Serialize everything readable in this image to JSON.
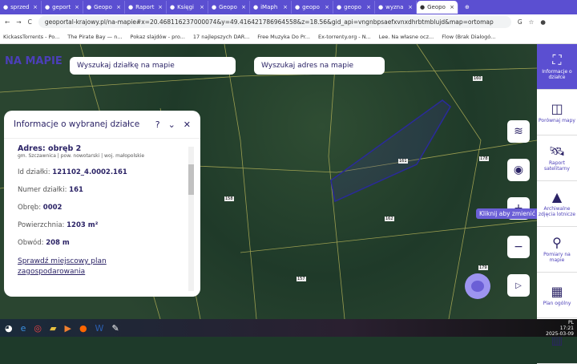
{
  "browser": {
    "tabs": [
      {
        "label": "sprzed"
      },
      {
        "label": "geport"
      },
      {
        "label": "Geopo"
      },
      {
        "label": "Raport"
      },
      {
        "label": "Księgi"
      },
      {
        "label": "Geopo"
      },
      {
        "label": "iMaph"
      },
      {
        "label": "geopo"
      },
      {
        "label": "geopo"
      },
      {
        "label": "wyzna"
      },
      {
        "label": "Geopo",
        "active": true
      }
    ],
    "url": "geoportal-krajowy.pl/na-mapie#x=20.468116237000074&y=49.416421786964558&z=18.56&gid_api=vngnbpsaefxvnxdhrbtmblujd&map=ortomap",
    "bookmarks": [
      "KickassTorrents - Po...",
      "The Pirate Bay — n...",
      "Pokaz slajdów - pro...",
      "17 najlepszych DAR...",
      "Free Muzyka Do Pr...",
      "Ex-torrenty.org - N...",
      "Lee. Na własne ocz...",
      "Flow (Brak Dialogó..."
    ]
  },
  "logo": "NA MAPIE",
  "search": {
    "parcel": "Wyszukaj działkę na mapie",
    "address": "Wyszukaj adres na mapie"
  },
  "panel": {
    "title": "Informacje o wybranej działce",
    "address": "Adres: obręb 2",
    "subaddress": "gm. Szczawnica | pow. nowotarski | woj. małopolskie",
    "fields": [
      {
        "label": "Id działki: ",
        "value": "121102_4.0002.161"
      },
      {
        "label": "Numer działki: ",
        "value": "161"
      },
      {
        "label": "Obręb: ",
        "value": "0002"
      },
      {
        "label": "Powierzchnia: ",
        "value": "1203 m²"
      },
      {
        "label": "Obwód: ",
        "value": "208 m"
      }
    ],
    "link": "Sprawdź miejscowy plan zagospodarowania"
  },
  "tooltip": "Kliknij aby zmienić",
  "map_labels": [
    "161",
    "160",
    "178",
    "179",
    "158",
    "157",
    "162"
  ],
  "sidebar": [
    {
      "label": "Informacje o działce",
      "icon": "⛶"
    },
    {
      "label": "Porównaj mapy",
      "icon": "◫"
    },
    {
      "label": "Raport satelitarny",
      "icon": "🛰"
    },
    {
      "label": "Archiwalne zdjęcia lotnicze",
      "icon": "▲"
    },
    {
      "label": "Pomiary na mapie",
      "icon": "⚲"
    },
    {
      "label": "Plan ogólny",
      "icon": "▦"
    },
    {
      "label": "",
      "icon": "▥"
    }
  ],
  "taskbar": {
    "lang": "PL",
    "time": "17:21",
    "date": "2025-03-09"
  }
}
